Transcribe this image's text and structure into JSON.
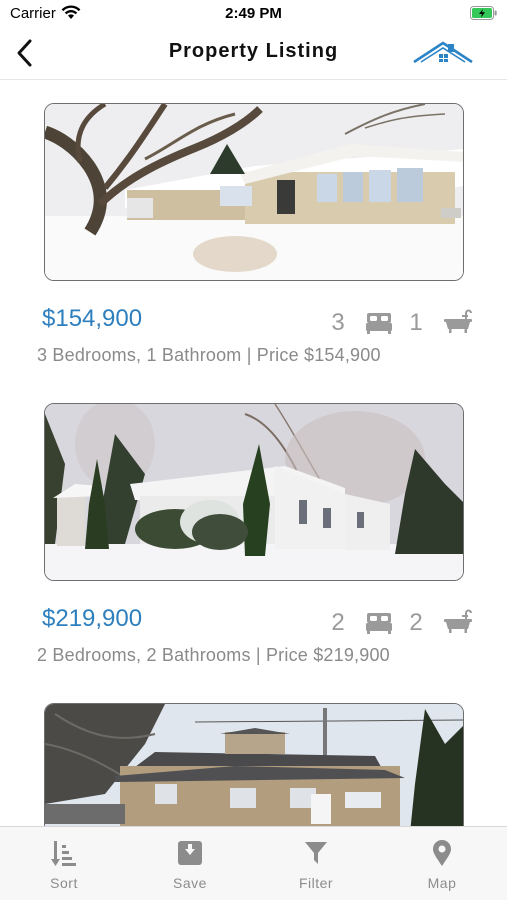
{
  "status_bar": {
    "carrier": "Carrier",
    "time": "2:49 PM"
  },
  "nav": {
    "title": "Property Listing",
    "back_icon": "chevron-left-icon",
    "logo_icon": "house-roof-icon"
  },
  "colors": {
    "price": "#2e7fbe",
    "muted_text": "#8a8a8a",
    "icon_gray": "#9a9a9a",
    "battery": "#34c759"
  },
  "listings": [
    {
      "price": "$154,900",
      "beds": "3",
      "baths": "1",
      "summary": "3 Bedrooms, 1 Bathroom | Price $154,900"
    },
    {
      "price": "$219,900",
      "beds": "2",
      "baths": "2",
      "summary": "2 Bedrooms, 2 Bathrooms | Price $219,900"
    },
    {
      "price": "",
      "beds": "",
      "baths": "",
      "summary": ""
    }
  ],
  "tabs": [
    {
      "label": "Sort",
      "icon": "sort-icon"
    },
    {
      "label": "Save",
      "icon": "save-icon"
    },
    {
      "label": "Filter",
      "icon": "filter-icon"
    },
    {
      "label": "Map",
      "icon": "map-pin-icon"
    }
  ]
}
